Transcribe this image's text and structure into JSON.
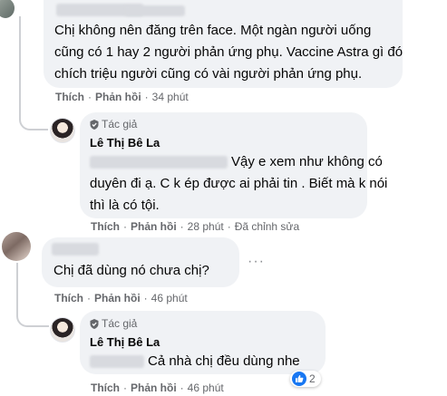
{
  "comments": [
    {
      "lines": [
        "Chị không nên đăng trên face. Một ngàn người uống",
        "cũng có 1 hay 2 người phản ứng phụ. Vaccine Astra gì đó",
        "chích triệu người cũng có vài người phản ứng phụ."
      ],
      "actions": {
        "like": "Thích",
        "reply": "Phản hồi",
        "time": "34 phút"
      }
    },
    {
      "badge": "Tác giả",
      "name": "Lê Thị Bê La",
      "lines": [
        "Vậy e xem như không có",
        "duyên đi ạ. C k ép được ai phải tin . Biết mà k nói",
        "thì là có tội."
      ],
      "actions": {
        "like": "Thích",
        "reply": "Phản hồi",
        "time": "28 phút",
        "edited": "Đã chỉnh sửa"
      }
    },
    {
      "lines": [
        "Chị đã dùng nó chưa chị?"
      ],
      "actions": {
        "like": "Thích",
        "reply": "Phản hồi",
        "time": "46 phút"
      }
    },
    {
      "badge": "Tác giả",
      "name": "Lê Thị Bê La",
      "lines": [
        "Cả nhà chị đều dùng nhe"
      ],
      "actions": {
        "like": "Thích",
        "reply": "Phản hồi",
        "time": "46 phút"
      },
      "reactions": {
        "count": "2",
        "type": "like-icon"
      }
    }
  ],
  "more_options": "···",
  "colors": {
    "bubble": "#f0f2f5",
    "meta": "#65676b",
    "like_blue": "#1877f2",
    "thread_line": "#ced0d4"
  }
}
